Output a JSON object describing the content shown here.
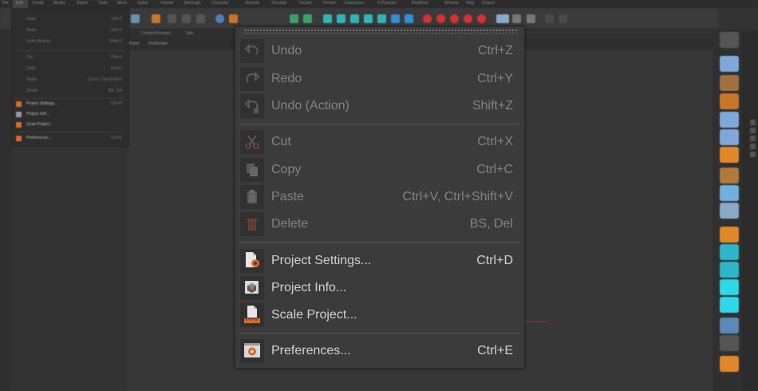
{
  "app": {
    "menubar": [
      "File",
      "Edit",
      "Create",
      "Modes",
      "Select",
      "Tools",
      "Mesh",
      "Spline",
      "Volume",
      "MoGraph",
      "Character",
      "Animate",
      "Simulate",
      "Tracker",
      "Render",
      "Extensions",
      "X-Particles",
      "RealFlow",
      "Window",
      "Help",
      "Octane"
    ],
    "subtabs": [
      "Content Browser",
      "Take"
    ],
    "viewbar": [
      "Panel",
      "ProRender"
    ]
  },
  "bg_menu": {
    "items": [
      {
        "label": "Undo",
        "shortcut": "Ctrl+Z"
      },
      {
        "label": "Redo",
        "shortcut": "Ctrl+Y"
      },
      {
        "label": "Undo (Action)",
        "shortcut": "Shift+Z"
      },
      {
        "label": "Cut",
        "shortcut": "Ctrl+X"
      },
      {
        "label": "Copy",
        "shortcut": "Ctrl+C"
      },
      {
        "label": "Paste",
        "shortcut": "Ctrl+V, Ctrl+Shift+V"
      },
      {
        "label": "Delete",
        "shortcut": "BS, Del"
      },
      {
        "label": "Project Settings...",
        "shortcut": "Ctrl+D"
      },
      {
        "label": "Project Info...",
        "shortcut": ""
      },
      {
        "label": "Scale Project...",
        "shortcut": ""
      },
      {
        "label": "Preferences...",
        "shortcut": "Ctrl+E"
      }
    ]
  },
  "edit_menu": {
    "groups": [
      {
        "items": [
          {
            "label": "Undo",
            "shortcut": "Ctrl+Z",
            "enabled": false,
            "icon": "undo-icon"
          },
          {
            "label": "Redo",
            "shortcut": "Ctrl+Y",
            "enabled": false,
            "icon": "redo-icon"
          },
          {
            "label": "Undo (Action)",
            "shortcut": "Shift+Z",
            "enabled": false,
            "icon": "undo-action-icon"
          }
        ]
      },
      {
        "items": [
          {
            "label": "Cut",
            "shortcut": "Ctrl+X",
            "enabled": false,
            "icon": "scissors-icon"
          },
          {
            "label": "Copy",
            "shortcut": "Ctrl+C",
            "enabled": false,
            "icon": "copy-icon"
          },
          {
            "label": "Paste",
            "shortcut": "Ctrl+V, Ctrl+Shift+V",
            "enabled": false,
            "icon": "paste-icon"
          },
          {
            "label": "Delete",
            "shortcut": "BS, Del",
            "enabled": false,
            "icon": "trash-icon"
          }
        ]
      },
      {
        "items": [
          {
            "label": "Project Settings...",
            "shortcut": "Ctrl+D",
            "enabled": true,
            "icon": "project-settings-icon"
          },
          {
            "label": "Project Info...",
            "shortcut": "",
            "enabled": true,
            "icon": "project-info-icon"
          },
          {
            "label": "Scale Project...",
            "shortcut": "",
            "enabled": true,
            "icon": "scale-project-icon"
          }
        ]
      },
      {
        "items": [
          {
            "label": "Preferences...",
            "shortcut": "Ctrl+E",
            "enabled": true,
            "icon": "preferences-icon"
          }
        ]
      }
    ]
  },
  "colors": {
    "accent_orange": "#e0672a",
    "text_enabled": "#d2d2d2",
    "text_disabled": "#838383",
    "menu_bg": "#3b3b3b"
  }
}
